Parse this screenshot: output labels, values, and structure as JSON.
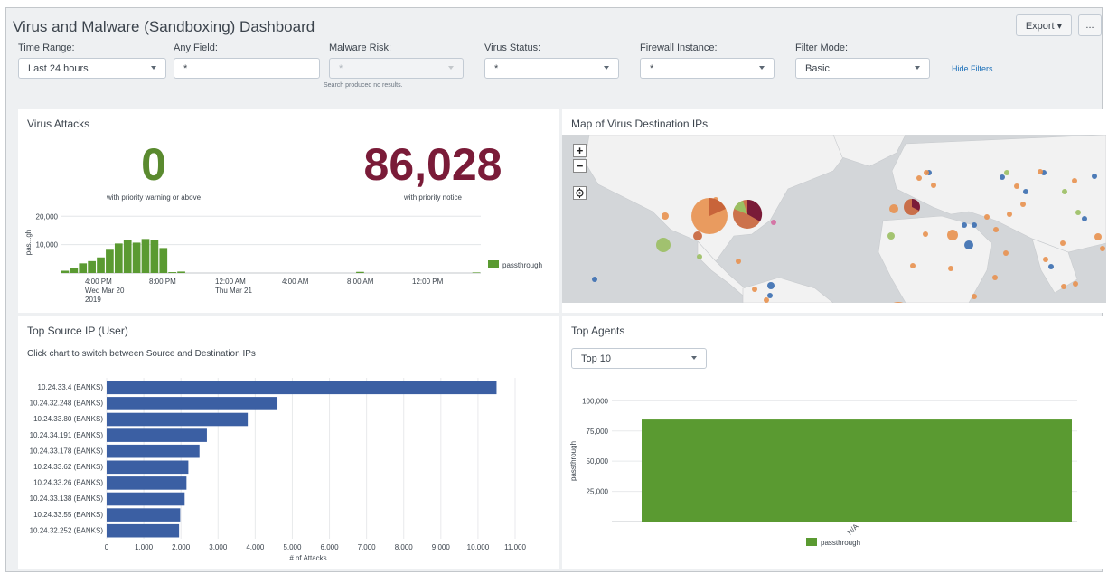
{
  "header": {
    "title": "Virus and Malware (Sandboxing) Dashboard",
    "export_label": "Export ▾",
    "more_label": "..."
  },
  "filters": [
    {
      "label": "Time Range:",
      "value": "Last 24 hours",
      "type": "dropdown",
      "disabled": false
    },
    {
      "label": "Any Field:",
      "value": "*",
      "type": "text",
      "disabled": false
    },
    {
      "label": "Malware Risk:",
      "value": "*",
      "type": "dropdown",
      "disabled": true
    },
    {
      "label": "Virus Status:",
      "value": "*",
      "type": "dropdown",
      "disabled": false
    },
    {
      "label": "Firewall Instance:",
      "value": "*",
      "type": "dropdown",
      "disabled": false
    },
    {
      "label": "Filter Mode:",
      "value": "Basic",
      "type": "dropdown",
      "disabled": false
    }
  ],
  "malware_hint": "Search produced no results.",
  "hide_filters_label": "Hide Filters",
  "virus_attacks": {
    "title": "Virus Attacks",
    "single_value_1": {
      "value": "0",
      "caption": "with priority warning or above",
      "color": "#5a8a2f"
    },
    "single_value_2": {
      "value": "86,028",
      "caption": "with priority notice",
      "color": "#7a1b38"
    }
  },
  "timechart": {
    "y_ticks": [
      "20,000",
      "10,000"
    ],
    "y_label": "pas...gh",
    "x_ticks": [
      {
        "lines": [
          "4:00 PM",
          "Wed Mar 20",
          "2019"
        ]
      },
      {
        "lines": [
          "8:00 PM"
        ]
      },
      {
        "lines": [
          "12:00 AM",
          "Thu Mar 21"
        ]
      },
      {
        "lines": [
          "4:00 AM"
        ]
      },
      {
        "lines": [
          "8:00 AM"
        ]
      },
      {
        "lines": [
          "12:00 PM"
        ]
      }
    ],
    "legend": "passthrough",
    "color": "#5a9a31"
  },
  "map": {
    "title": "Map of Virus Destination IPs",
    "zoom_in": "+",
    "zoom_out": "−"
  },
  "top_source": {
    "title": "Top Source IP (User)",
    "instruction": "Click chart to switch between Source and Destination IPs",
    "x_label": "# of Attacks",
    "x_ticks": [
      "0",
      "1,000",
      "2,000",
      "3,000",
      "4,000",
      "5,000",
      "6,000",
      "7,000",
      "8,000",
      "9,000",
      "10,000",
      "11,000"
    ],
    "bar_color": "#3b5fa3"
  },
  "top_agents": {
    "title": "Top Agents",
    "select_value": "Top 10",
    "y_label": "passthrough",
    "y_ticks": [
      "100,000",
      "75,000",
      "50,000",
      "25,000"
    ],
    "legend": "passthrough",
    "bar_color": "#5a9a31"
  },
  "chart_data": [
    {
      "type": "bar",
      "title": "Virus Attacks",
      "ylabel": "pas...gh",
      "ylim": [
        0,
        22000
      ],
      "series": [
        {
          "name": "passthrough",
          "values": [
            800,
            1800,
            3400,
            4200,
            5500,
            8200,
            10400,
            11500,
            10700,
            12000,
            11600,
            8800,
            300,
            500,
            0,
            0,
            0,
            0,
            0,
            0,
            0,
            0,
            0,
            0,
            0,
            0,
            0,
            0,
            0,
            0,
            0,
            0,
            0,
            400,
            0,
            0,
            0,
            0,
            0,
            0,
            0,
            0,
            0,
            0,
            0,
            0,
            200
          ]
        }
      ]
    },
    {
      "type": "bar",
      "title": "Top Source IP (User)",
      "xlabel": "# of Attacks",
      "xlim": [
        0,
        11000
      ],
      "categories": [
        "10.24.33.4 (BANKS)",
        "10.24.32.248 (BANKS)",
        "10.24.33.80 (BANKS)",
        "10.24.34.191 (BANKS)",
        "10.24.33.178 (BANKS)",
        "10.24.33.62 (BANKS)",
        "10.24.33.26 (BANKS)",
        "10.24.33.138 (BANKS)",
        "10.24.33.55 (BANKS)",
        "10.24.32.252 (BANKS)"
      ],
      "values": [
        10500,
        4600,
        3800,
        2700,
        2500,
        2200,
        2150,
        2100,
        1980,
        1950
      ]
    },
    {
      "type": "bar",
      "title": "Top Agents",
      "ylabel": "passthrough",
      "ylim": [
        0,
        110000
      ],
      "categories": [
        "N/A"
      ],
      "series": [
        {
          "name": "passthrough",
          "values": [
            84500
          ]
        }
      ]
    }
  ]
}
